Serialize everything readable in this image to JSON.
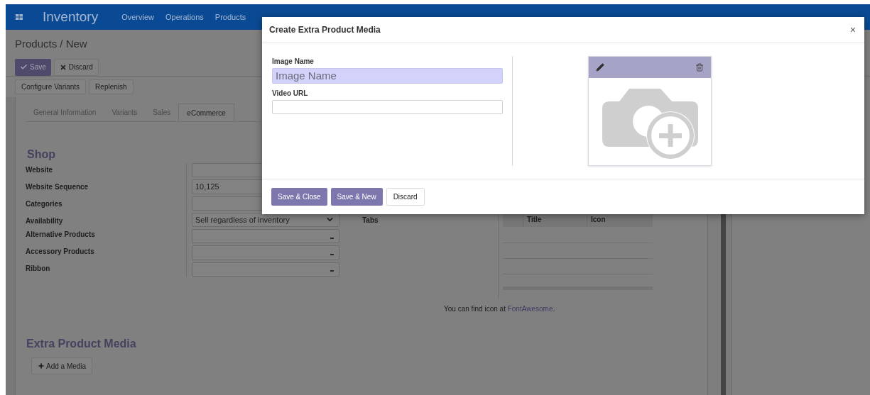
{
  "navbar": {
    "app_name": "Inventory",
    "menu": [
      "Overview",
      "Operations",
      "Products"
    ]
  },
  "breadcrumb": "Products / New",
  "actions": [
    {
      "label": "Save",
      "kind": "primary"
    },
    {
      "label": "Discard",
      "kind": "secondary"
    }
  ],
  "header_buttons": [
    "Configure Variants",
    "Replenish"
  ],
  "tabs": [
    {
      "label": "General Information",
      "selected": false
    },
    {
      "label": "Variants",
      "selected": false
    },
    {
      "label": "Sales",
      "selected": false
    },
    {
      "label": "eCommerce",
      "selected": true
    }
  ],
  "shop": {
    "title": "Shop",
    "fields": [
      {
        "label": "Website",
        "kind": "char"
      },
      {
        "label": "Website Sequence",
        "kind": "char",
        "value": "10,125"
      },
      {
        "label": "Categories",
        "kind": "char"
      },
      {
        "label": "Availability",
        "kind": "select",
        "value": "Sell regardless of inventory"
      },
      {
        "label": "Alternative Products",
        "kind": "many2one"
      },
      {
        "label": "Accessory Products",
        "kind": "many2one"
      },
      {
        "label": "Ribbon",
        "kind": "many2one"
      }
    ]
  },
  "tabs_section": {
    "label": "Tabs",
    "columns": [
      "Title",
      "Icon"
    ],
    "hint": "You can find icon at",
    "link": "FontAwesome",
    "hint_end": "."
  },
  "media": {
    "title": "Extra Product Media",
    "add_button": "Add a Media"
  },
  "dialog": {
    "title": "Create Extra Product Media",
    "close": "×",
    "fields": [
      {
        "label": "Image Name",
        "placeholder": "Image Name",
        "focused": true
      },
      {
        "label": "Video URL",
        "focused": false
      }
    ],
    "buttons": [
      {
        "label": "Save & Close",
        "kind": "primary"
      },
      {
        "label": "Save & New",
        "kind": "primary"
      },
      {
        "label": "Discard",
        "kind": "secondary"
      }
    ]
  }
}
